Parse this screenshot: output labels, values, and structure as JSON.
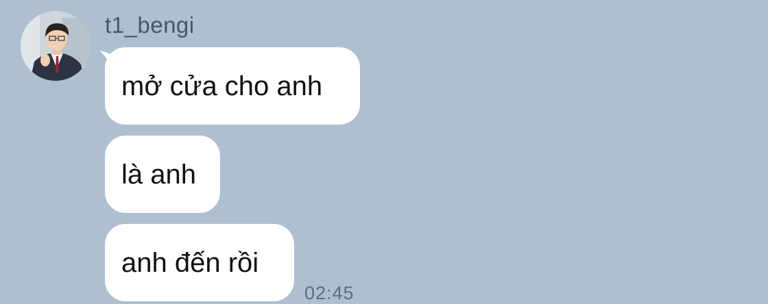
{
  "chat": {
    "sender_name": "t1_bengi",
    "messages": [
      {
        "text": "mở cửa cho anh"
      },
      {
        "text": "là anh"
      },
      {
        "text": "anh đến rồi"
      }
    ],
    "timestamp": "02:45"
  },
  "colors": {
    "background": "#aebfd1",
    "bubble": "#ffffff",
    "text": "#111111",
    "meta_text": "#5f6d7b"
  },
  "icons": {
    "avatar": "profile-photo"
  }
}
